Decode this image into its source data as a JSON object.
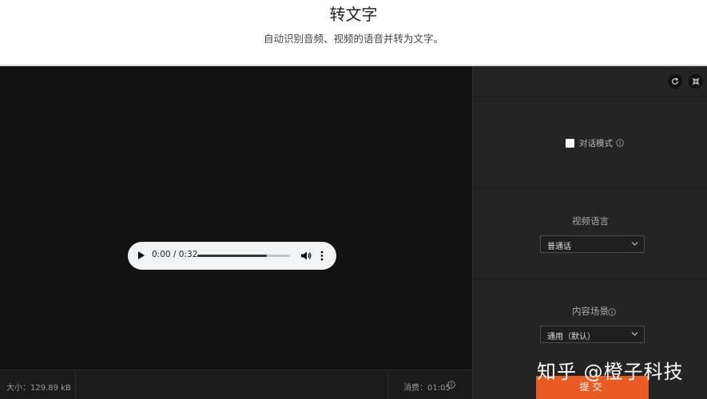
{
  "header": {
    "title": "转文字",
    "subtitle": "自动识别音频、视频的语音并转为文字。"
  },
  "player": {
    "time": "0:00 / 0:32",
    "progress_fraction": 0.75,
    "play_icon": "play-icon",
    "volume_icon": "volume-icon",
    "more_icon": "more-vert-icon"
  },
  "footer": {
    "size": "大小：129.89 kB",
    "cost": "消费：01:05"
  },
  "panel": {
    "toolbar_icons": [
      "refresh-icon",
      "collapse-icon"
    ],
    "dialogue_mode": {
      "label": "对话模式",
      "checked": false
    },
    "language": {
      "label": "视频语言",
      "value": "普通话"
    },
    "scene": {
      "label": "内容场景",
      "value": "通用（默认）"
    },
    "submit_label": "提交"
  },
  "watermark": "知乎 @橙子科技",
  "colors": {
    "accent": "#ea5a24",
    "stage_bg": "#121212",
    "panel_bg": "#242424"
  }
}
